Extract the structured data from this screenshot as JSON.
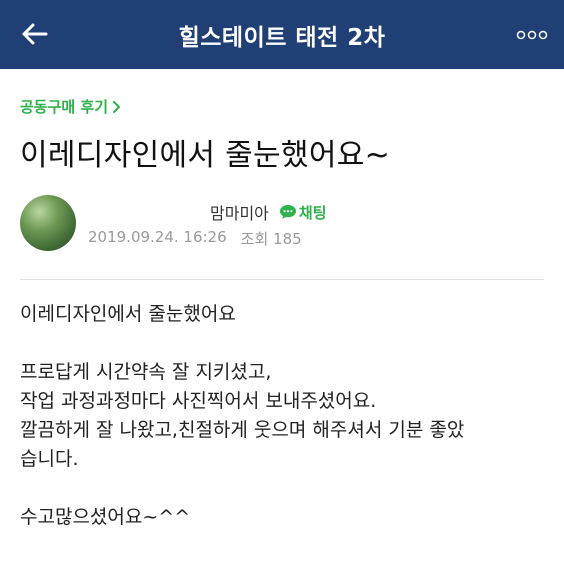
{
  "header": {
    "title": "힐스테이트 태전 2차",
    "back_icon": "arrow-left-icon",
    "more_icon": "more-dots-icon",
    "background_color": "#1f3f75"
  },
  "post": {
    "category": "공동구매 후기",
    "title": "이레디자인에서 줄눈했어요~",
    "author": "맘마미아",
    "chat_label": "채팅",
    "date": "2019.09.24. 16:26",
    "views": "조회 185",
    "body": {
      "line1": "이레디자인에서 줄눈했어요",
      "line2": "프로답게 시간약속 잘 지키셨고,",
      "line3": "작업 과정과정마다 사진찍어서 보내주셨어요.",
      "line4": "깔끔하게 잘 나왔고,친절하게 웃으며 해주셔서 기분 좋았",
      "line5": "습니다.",
      "line6": "수고많으셨어요~^^"
    }
  },
  "colors": {
    "accent_green": "#2db34a",
    "meta_gray": "#9a9a9a"
  }
}
